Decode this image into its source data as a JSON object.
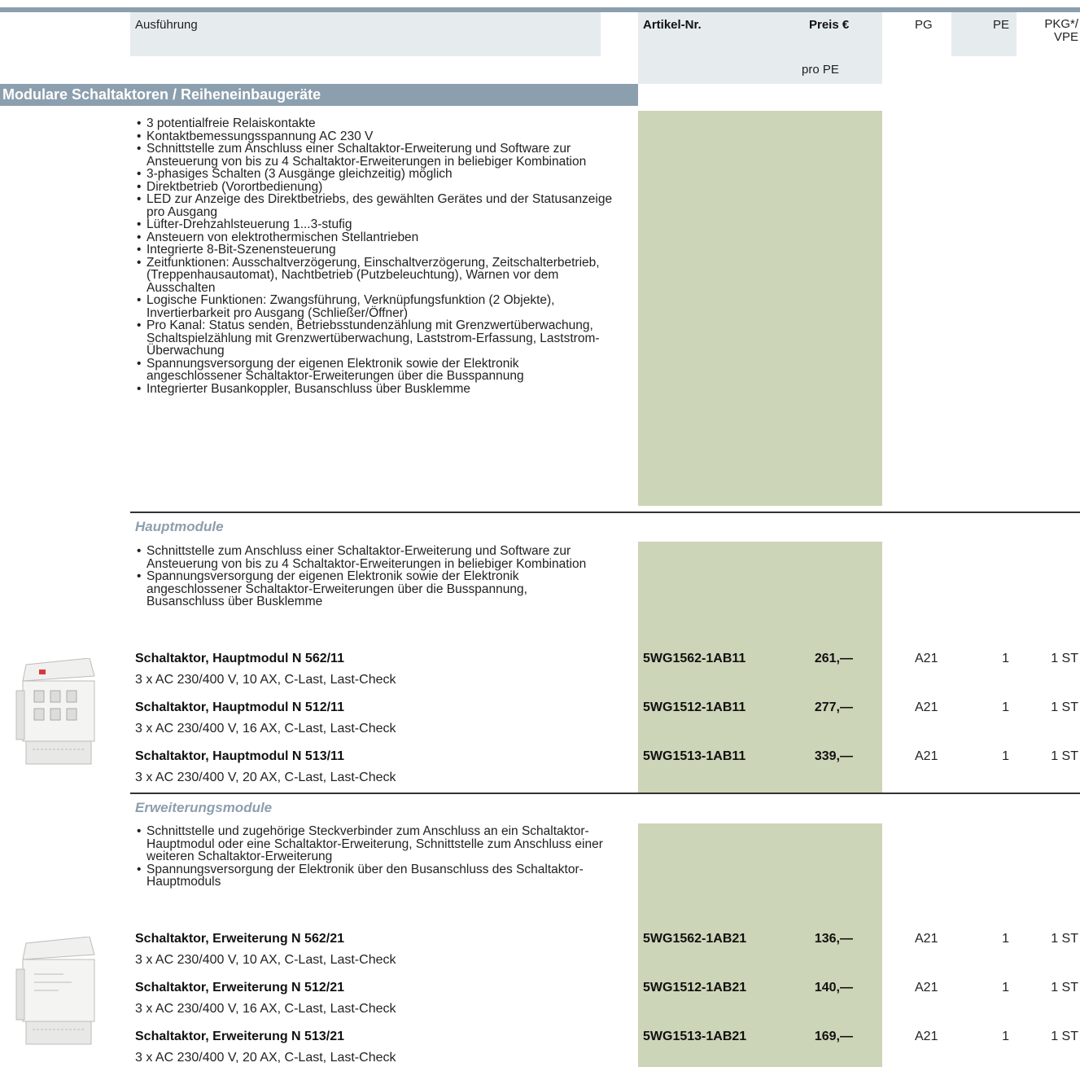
{
  "header": {
    "ausfuehrung": "Ausführung",
    "artikel_nr": "Artikel-Nr.",
    "preis": "Preis €",
    "pro_pe": "pro PE",
    "pg": "PG",
    "pe": "PE",
    "pkg_line1": "PKG*/",
    "pkg_line2": "VPE"
  },
  "section_title": "Modulare Schaltaktoren / Reiheneinbaugeräte",
  "general_features": [
    "3 potentialfreie Relaiskontakte",
    "Kontaktbemessungsspannung AC 230 V",
    "Schnittstelle zum Anschluss einer Schaltaktor-Erweiterung und Software zur Ansteuerung von bis zu 4 Schaltaktor-Erweiterungen in beliebiger Kombination",
    "3-phasiges Schalten (3 Ausgänge gleichzeitig) möglich",
    "Direktbetrieb (Vorortbedienung)",
    "LED zur Anzeige des Direktbetriebs, des gewählten Gerätes und der Statusanzeige pro Ausgang",
    "Lüfter-Drehzahlsteuerung 1...3-stufig",
    "Ansteuern von elektrothermischen Stellantrieben",
    "Integrierte 8-Bit-Szenensteuerung",
    "Zeitfunktionen: Ausschaltverzögerung, Einschaltverzögerung, Zeitschalterbetrieb, (Treppenhausautomat), Nachtbetrieb (Putzbeleuchtung), Warnen vor dem Ausschalten",
    "Logische Funktionen: Zwangsführung, Verknüpfungsfunktion (2 Objekte), Invertierbarkeit pro Ausgang (Schließer/Öffner)",
    "Pro Kanal: Status senden, Betriebsstundenzählung mit Grenzwertüberwachung, Schaltspielzählung mit Grenzwertüberwachung, Laststrom-Erfassung, Laststrom-Überwachung",
    "Spannungsversorgung der eigenen Elektronik sowie der Elektronik angeschlossener Schaltaktor-Erweiterungen über die Busspannung",
    "Integrierter Busankoppler, Busanschluss über Busklemme"
  ],
  "hauptmodule": {
    "title": "Hauptmodule",
    "features": [
      "Schnittstelle zum Anschluss einer Schaltaktor-Erweiterung und Software zur Ansteuerung von bis zu 4 Schaltaktor-Erweiterungen in beliebiger Kombination",
      "Spannungsversorgung der eigenen Elektronik sowie der Elektronik angeschlossener Schaltaktor-Erweiterungen über die Busspannung, Busanschluss über Busklemme"
    ],
    "products": [
      {
        "name": "Schaltaktor, Hauptmodul N 562/11",
        "spec": "3 x AC 230/400 V, 10 AX, C-Last, Last-Check",
        "art": "5WG1562-1AB11",
        "price": "261,—",
        "pg": "A21",
        "pe": "1",
        "pkg": "1 ST"
      },
      {
        "name": "Schaltaktor, Hauptmodul N 512/11",
        "spec": "3 x AC 230/400 V, 16 AX, C-Last, Last-Check",
        "art": "5WG1512-1AB11",
        "price": "277,—",
        "pg": "A21",
        "pe": "1",
        "pkg": "1 ST"
      },
      {
        "name": "Schaltaktor, Hauptmodul N 513/11",
        "spec": "3 x AC 230/400 V, 20 AX, C-Last, Last-Check",
        "art": "5WG1513-1AB11",
        "price": "339,—",
        "pg": "A21",
        "pe": "1",
        "pkg": "1 ST"
      }
    ]
  },
  "erweiterungsmodule": {
    "title": "Erweiterungsmodule",
    "features": [
      "Schnittstelle und zugehörige Steckverbinder zum Anschluss an ein Schaltaktor-Hauptmodul oder eine Schaltaktor-Erweiterung, Schnittstelle zum Anschluss einer weiteren Schaltaktor-Erweiterung",
      "Spannungsversorgung der Elektronik über den Busanschluss des Schaltaktor-Hauptmoduls"
    ],
    "products": [
      {
        "name": "Schaltaktor, Erweiterung N 562/21",
        "spec": "3 x AC 230/400 V, 10 AX, C-Last, Last-Check",
        "art": "5WG1562-1AB21",
        "price": "136,—",
        "pg": "A21",
        "pe": "1",
        "pkg": "1 ST"
      },
      {
        "name": "Schaltaktor, Erweiterung N 512/21",
        "spec": "3 x AC 230/400 V, 16 AX, C-Last, Last-Check",
        "art": "5WG1512-1AB21",
        "price": "140,—",
        "pg": "A21",
        "pe": "1",
        "pkg": "1 ST"
      },
      {
        "name": "Schaltaktor, Erweiterung N 513/21",
        "spec": "3 x AC 230/400 V, 20 AX, C-Last, Last-Check",
        "art": "5WG1513-1AB21",
        "price": "169,—",
        "pg": "A21",
        "pe": "1",
        "pkg": "1 ST"
      }
    ]
  }
}
